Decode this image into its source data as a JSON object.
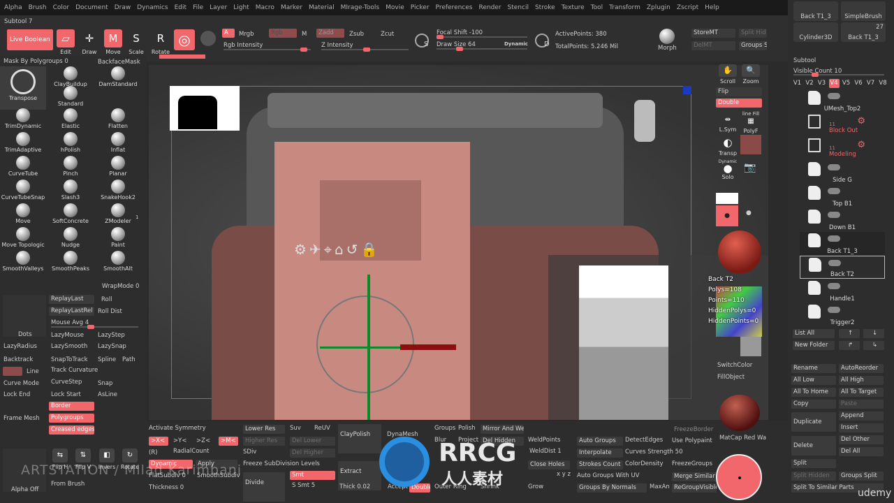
{
  "menu": [
    "Alpha",
    "Brush",
    "Color",
    "Document",
    "Draw",
    "Dynamics",
    "Edit",
    "File",
    "Layer",
    "Light",
    "Macro",
    "Marker",
    "Material",
    "MIrage-Tools",
    "Movie",
    "Picker",
    "Preferences",
    "Render",
    "Stencil",
    "Stroke",
    "Texture",
    "Tool",
    "Transform",
    "Zplugin",
    "Zscript",
    "Help"
  ],
  "shelf": {
    "subtool_label": "Subtool 7",
    "live_boolean": "Live Boolean",
    "edit": "Edit",
    "draw": "Draw",
    "move": "Move",
    "scale": "Scale",
    "rotate": "Rotate",
    "a": "A",
    "mrgb": "Mrgb",
    "rgb": "Rgb",
    "m": "M",
    "zadd": "Zadd",
    "zsub": "Zsub",
    "zcut": "Zcut",
    "rgb_intensity": "Rgb Intensity",
    "z_intensity": "Z Intensity",
    "focal_shift": "Focal Shift -100",
    "draw_size": "Draw Size 64",
    "dynamic": "Dynamic",
    "active_points": "ActivePoints: 380",
    "total_points": "TotalPoints: 5.246 Mil",
    "morph": "Morph",
    "storemt": "StoreMT",
    "delmt": "DelMT",
    "split_hid": "Split Hid",
    "groups_s": "Groups S",
    "s": "S",
    "d": "D"
  },
  "tool_thumbs": [
    {
      "label": "Back T1_3"
    },
    {
      "label": "SimpleBrush"
    },
    {
      "label": "Cylinder3D"
    },
    {
      "label": "Back T1_3",
      "count": "27"
    }
  ],
  "left": {
    "mask_by_polygroups": "Mask By Polygroups 0",
    "backface_mask": "BackfaceMask",
    "brushes": [
      "Transpose",
      "ClayBuildup",
      "DamStandard",
      "Standard",
      "TrimDynamic",
      "Elastic",
      "Flatten",
      "TrimAdaptive",
      "hPolish",
      "Inflat",
      "CurveTube",
      "Pinch",
      "Planar",
      "CurveTubeSnap",
      "Slash3",
      "SnakeHook2",
      "Move",
      "SoftConcrete",
      "ZModeler",
      "Move Topologic",
      "Nudge",
      "Paint",
      "SmoothValleys",
      "SmoothPeaks",
      "SmoothAlt"
    ],
    "zmodeler_badge": "1",
    "wrap_mode": "WrapMode 0",
    "replay_last": "ReplayLast",
    "roll": "Roll",
    "replay_last_rel": "ReplayLastRel",
    "roll_dist": "Roll Dist",
    "mouse_avg": "Mouse Avg 4",
    "dots": "Dots",
    "lazy_mouse": "LazyMouse",
    "lazy_step": "LazyStep",
    "lazy_radius": "LazyRadius",
    "lazy_smooth": "LazySmooth",
    "lazy_snap": "LazySnap",
    "backtrack": "Backtrack",
    "snap_to_track": "SnapToTrack",
    "spline": "Spline",
    "path": "Path",
    "line": "Line",
    "track_curvature": "Track Curvature",
    "curve_mode": "Curve Mode",
    "curve_step": "CurveStep",
    "snap": "Snap",
    "lock_end": "Lock End",
    "lock_start": "Lock Start",
    "as_line": "AsLine",
    "frame_mesh": "Frame Mesh",
    "border": "Border",
    "polygroups": "Polygroups",
    "creased_edges": "Creased edges",
    "flip_h": "Flip H",
    "flip_v": "Flip V",
    "invers": "Invers",
    "rotate": "Rotate",
    "from_brush": "From Brush",
    "alpha_off": "Alpha Off"
  },
  "viewport": {
    "info": {
      "name": "Back T2",
      "polys": "Polys=108",
      "points": "Points=110",
      "hidden_polys": "HiddenPolys=0",
      "hidden_points": "HiddenPoints=0"
    }
  },
  "tray": {
    "scroll": "Scroll",
    "zoom": "Zoom",
    "flip": "Flip",
    "double": "Double",
    "lsym": "L.Sym",
    "polyf": "PolyF",
    "line_fill": "line Fill",
    "transp": "Transp",
    "dynamic": "Dynamic",
    "solo": "Solo",
    "switch_color": "SwitchColor",
    "fill_object": "FillObject",
    "matcap": "MatCap Red Wa",
    "freeze_border": "FreezeBorder"
  },
  "subtool": {
    "title": "Subtool",
    "visible_count": "Visible Count 10",
    "visible_fraction": 0.2,
    "versions": [
      "V1",
      "V2",
      "V3",
      "V4",
      "V5",
      "V6",
      "V7",
      "V8"
    ],
    "active_version": "V4",
    "items": [
      {
        "name": "UMesh_Top2"
      },
      {
        "name": "Block Out",
        "count": "11",
        "folder": true
      },
      {
        "name": "Modeling",
        "count": "11",
        "folder": true
      },
      {
        "name": "Side G"
      },
      {
        "name": "Top B1"
      },
      {
        "name": "Down B1"
      },
      {
        "name": "Back T1_3"
      },
      {
        "name": "Back T2",
        "selected": true
      },
      {
        "name": "Handle1"
      },
      {
        "name": "Trigger2"
      }
    ],
    "list_all": "List All",
    "new_folder": "New Folder",
    "rename": "Rename",
    "auto_reorder": "AutoReorder",
    "all_low": "All Low",
    "all_high": "All High",
    "all_to_home": "All To Home",
    "all_to_target": "All To Target",
    "copy": "Copy",
    "paste": "Paste",
    "duplicate": "Duplicate",
    "append": "Append",
    "insert": "Insert",
    "delete": "Delete",
    "del_other": "Del Other",
    "del_all": "Del All",
    "split": "Split",
    "split_hidden": "Split Hidden",
    "groups_split": "Groups Split",
    "split_similar": "Split To Similar Parts"
  },
  "bottom": {
    "activate_symmetry": "Activate Symmetry",
    "x": ">X<",
    "y": ">Y<",
    "z": ">Z<",
    "m": ">M<",
    "r": "(R)",
    "radial_count": "RadialCount",
    "dynamic": "Dynamic",
    "apply": "Apply",
    "flat_subdiv": "FlatSubdiv 0",
    "smooth_subdiv": "SmoothSubdiv",
    "thickness": "Thickness 0",
    "lower_res": "Lower Res",
    "suv": "Suv",
    "reuv": "ReUV",
    "higher_res": "Higher Res",
    "del_lower": "Del Lower",
    "sdiv": "SDiv",
    "del_higher": "Del Higher",
    "freeze_subdiv": "Freeze SubDivision Levels",
    "divide": "Divide",
    "smt": "Smt",
    "s_smt": "S Smt 5",
    "claypolish": "ClayPolish",
    "extract": "Extract",
    "thick": "Thick 0.02",
    "accept": "Accept",
    "double": "Double",
    "dynamesh": "DynaMesh",
    "groups": "Groups",
    "polish": "Polish",
    "blur": "Blur",
    "project": "Project",
    "mirror_weld": "Mirror And Weld",
    "del_hidden": "Del Hidden",
    "weld_points": "WeldPoints",
    "weld_dist": "WeldDist 1",
    "close_holes": "Close Holes",
    "outer_ring": "Outer Ring",
    "shrink": "Shrink",
    "grow": "Grow",
    "xyz": "x y z",
    "auto_groups": "Auto Groups",
    "detect_edges": "DetectEdges",
    "use_polypaint": "Use Polypaint",
    "interpolate": "Interpolate",
    "curves_strength": "Curves Strength 50",
    "strokes_count": "Strokes Count",
    "color_density": "ColorDensity",
    "freeze_groups": "FreezeGroups",
    "auto_groups_uv": "Auto Groups With UV",
    "merge_similar": "Merge Similar",
    "groups_by_normals": "Groups By Normals",
    "max_an": "MaxAn",
    "regroup_visible": "ReGroupVisible"
  },
  "watermarks": {
    "artstation": "ARTSTATION / Milad Karimbani",
    "rrcg": "RRCG",
    "rrcg_cn": "人人素材",
    "udemy": "udemy"
  },
  "colors": {
    "accent": "#f2676b",
    "panel": "#2d2d2d",
    "viewport": "#3b3b3b",
    "model": "#c88a80"
  }
}
